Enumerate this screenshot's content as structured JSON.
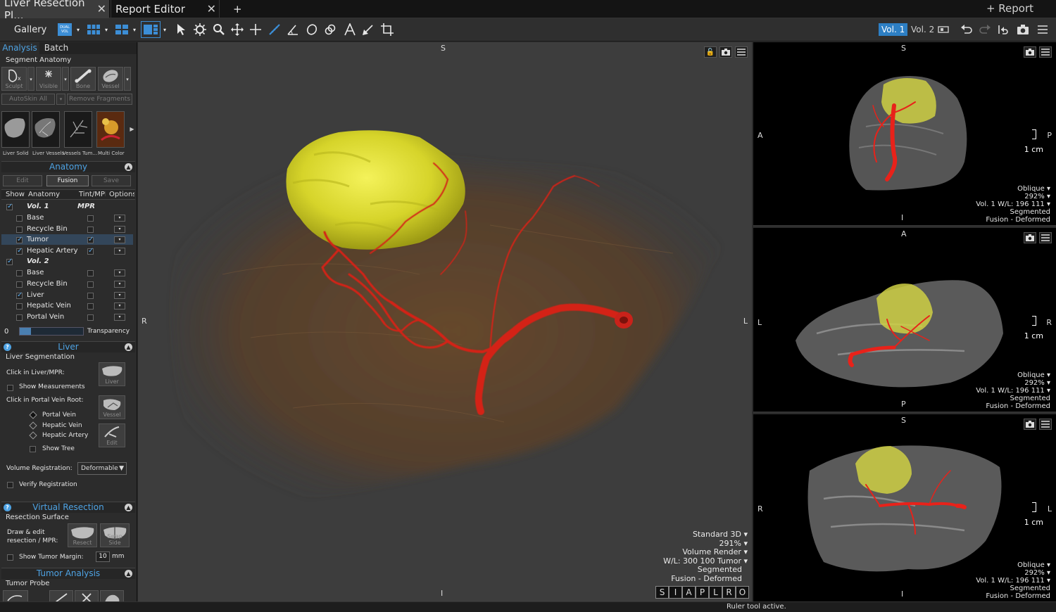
{
  "tabs": [
    {
      "label": "Liver Resection Pl...",
      "active": true
    },
    {
      "label": "Report Editor",
      "active": false
    }
  ],
  "tab_add": "+",
  "report_link": "+ Report",
  "toolbar": {
    "gallery": "Gallery",
    "dual_vol": "DUAL VOL",
    "vol1": "Vol. 1",
    "vol2": "Vol. 2"
  },
  "left_tabs": {
    "analysis": "Analysis",
    "batch": "Batch"
  },
  "segment_anatomy": {
    "title": "Segment Anatomy",
    "tools": [
      "Sculpt",
      "Visible",
      "Bone",
      "Vessel"
    ],
    "autoskin": "AutoSkin All",
    "remove_fragments": "Remove Fragments",
    "presets": [
      "Liver Solid",
      "Liver Vessels",
      "Vessels Tum...",
      "Multi Color"
    ]
  },
  "anatomy": {
    "title": "Anatomy",
    "buttons": {
      "edit": "Edit",
      "fusion": "Fusion",
      "save": "Save"
    },
    "columns": [
      "Show",
      "Anatomy",
      "Tint/MPR",
      "Options"
    ],
    "vol1": {
      "label": "Vol. 1",
      "tint": "MPR"
    },
    "vol1_items": [
      {
        "name": "Base",
        "show": false,
        "tint": false
      },
      {
        "name": "Recycle Bin",
        "show": false,
        "tint": false
      },
      {
        "name": "Tumor",
        "show": true,
        "tint": true
      },
      {
        "name": "Hepatic Artery",
        "show": true,
        "tint": true
      }
    ],
    "vol2": {
      "label": "Vol. 2"
    },
    "vol2_items": [
      {
        "name": "Base",
        "show": false,
        "tint": false
      },
      {
        "name": "Recycle Bin",
        "show": false,
        "tint": false
      },
      {
        "name": "Liver",
        "show": true,
        "tint": false
      },
      {
        "name": "Hepatic Vein",
        "show": false,
        "tint": false
      },
      {
        "name": "Portal Vein",
        "show": false,
        "tint": false
      }
    ],
    "transparency_value": "0",
    "transparency_label": "Transparency"
  },
  "liver": {
    "title": "Liver",
    "segmentation": "Liver Segmentation",
    "click_liver": "Click in Liver/MPR:",
    "liver_btn": "Liver",
    "show_measurements": "Show Measurements",
    "click_portal": "Click in Portal Vein Root:",
    "vessel_btn": "Vessel",
    "edit_btn": "Edit",
    "vessel_options": [
      {
        "label": "Portal Vein",
        "selected": true
      },
      {
        "label": "Hepatic Vein",
        "selected": false
      },
      {
        "label": "Hepatic Artery",
        "selected": false
      }
    ],
    "show_tree": "Show Tree",
    "volume_registration": "Volume Registration:",
    "registration_value": "Deformable",
    "verify_registration": "Verify Registration"
  },
  "virtual_resection": {
    "title": "Virtual Resection",
    "surface": "Resection Surface",
    "draw_edit_1": "Draw & edit",
    "draw_edit_2": "resection / MPR:",
    "resect_btn": "Resect",
    "swap_btn": "Swap Side",
    "show_margin": "Show Tumor Margin:",
    "margin_value": "10",
    "margin_unit": "mm"
  },
  "tumor_analysis": {
    "title": "Tumor Analysis",
    "probe": "Tumor Probe"
  },
  "main_view": {
    "top": "S",
    "bottom": "I",
    "left": "R",
    "right": "L",
    "overlay": [
      "Standard 3D",
      "291%",
      "Volume Render",
      "W/L: 300 100 Tumor",
      "Segmented",
      "Fusion - Deformed"
    ],
    "orient_buttons": [
      "S",
      "I",
      "A",
      "P",
      "L",
      "R",
      "O"
    ]
  },
  "side_views": [
    {
      "top": "S",
      "bottom": "I",
      "left": "A",
      "right": "P",
      "scale": "1 cm",
      "overlay": [
        "Oblique",
        "292%",
        "Vol. 1 W/L: 196 111",
        "Segmented",
        "Fusion - Deformed"
      ]
    },
    {
      "top": "A",
      "bottom": "P",
      "left": "L",
      "right": "R",
      "scale": "1 cm",
      "overlay": [
        "Oblique",
        "292%",
        "Vol. 1 W/L: 196 111",
        "Segmented",
        "Fusion - Deformed"
      ]
    },
    {
      "top": "S",
      "bottom": "I",
      "left": "R",
      "right": "L",
      "scale": "1 cm",
      "overlay": [
        "Oblique",
        "292%",
        "Vol. 1 W/L: 196 111",
        "Segmented",
        "Fusion - Deformed"
      ]
    }
  ],
  "status": "Ruler tool active."
}
